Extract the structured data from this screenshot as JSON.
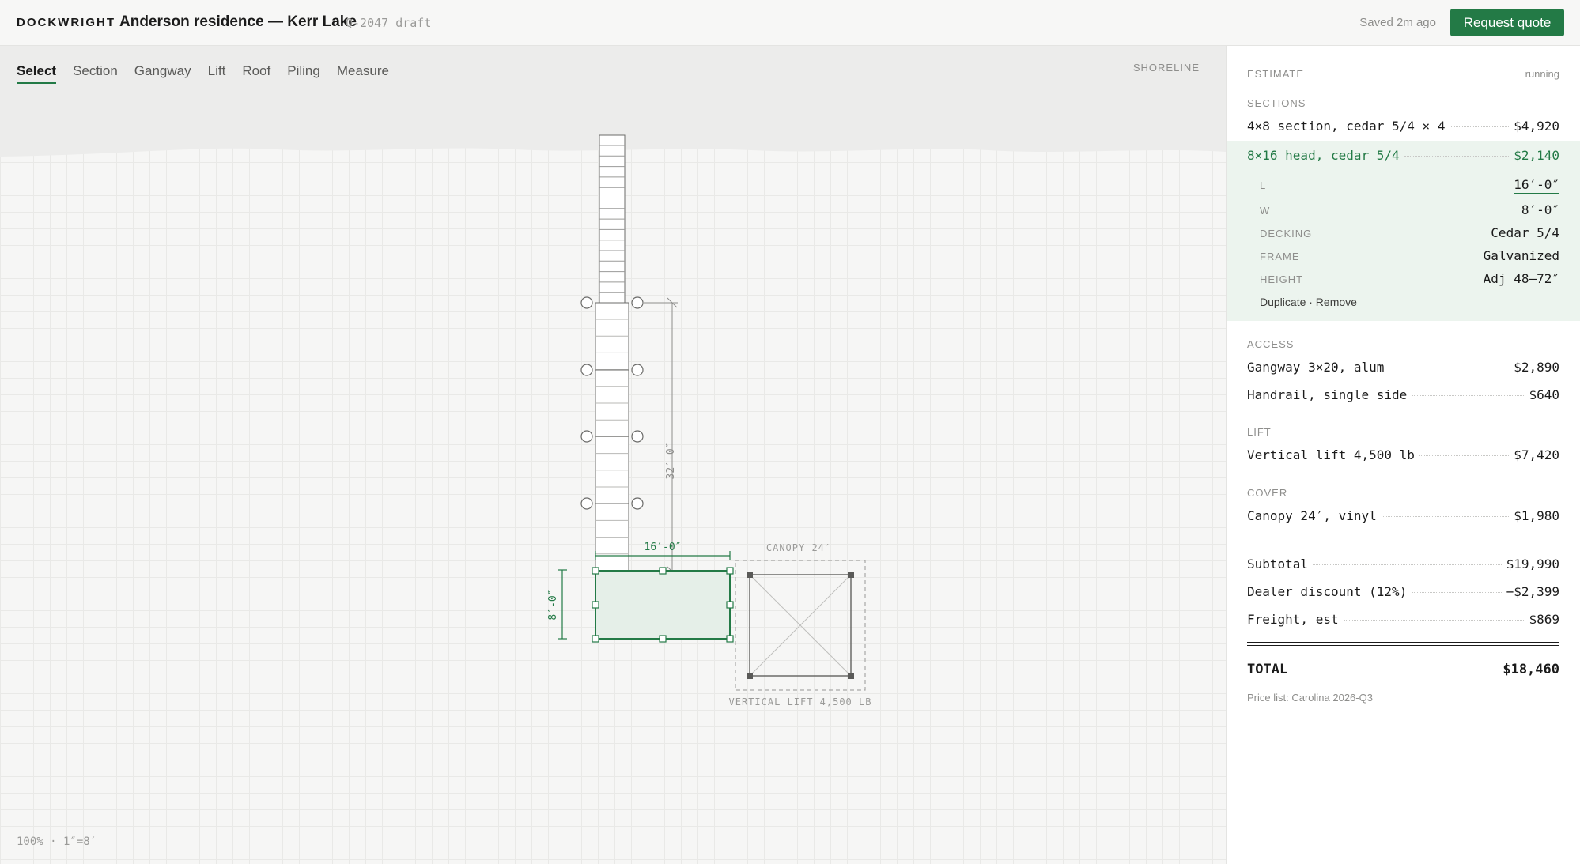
{
  "header": {
    "brand": "DOCKWRIGHT",
    "project_title": "Anderson residence — Kerr Lake",
    "quote_id": "Q-2047 draft",
    "saved_status": "Saved 2m ago",
    "request_quote_label": "Request quote"
  },
  "toolbar": {
    "tools": [
      "Select",
      "Section",
      "Gangway",
      "Lift",
      "Roof",
      "Piling",
      "Measure"
    ],
    "active": "Select"
  },
  "canvas": {
    "shoreline_label": "SHORELINE",
    "zoom_label": "100% · 1″=8′",
    "dim_length": "32′-0″",
    "dim_head_width": "16′-0″",
    "dim_head_depth": "8′-0″",
    "canopy_label": "CANOPY 24′",
    "lift_label": "VERTICAL LIFT 4,500 LB",
    "colors": {
      "accent": "#237a46",
      "selected_fill": "#e5efe8",
      "line": "#6b6b69"
    }
  },
  "estimate": {
    "title": "ESTIMATE",
    "status": "running",
    "sections_label": "SECTIONS",
    "sections": [
      {
        "name": "4×8 section, cedar 5/4 × 4",
        "price": "$4,920"
      },
      {
        "name": "8×16 head, cedar 5/4",
        "price": "$2,140"
      }
    ],
    "selected_props": [
      {
        "key": "L",
        "value": "16′-0″"
      },
      {
        "key": "W",
        "value": "8′-0″"
      },
      {
        "key": "DECKING",
        "value": "Cedar 5/4"
      },
      {
        "key": "FRAME",
        "value": "Galvanized"
      },
      {
        "key": "HEIGHT",
        "value": "Adj 48–72″"
      }
    ],
    "selected_actions": "Duplicate · Remove",
    "access_label": "ACCESS",
    "access": [
      {
        "name": "Gangway 3×20, alum",
        "price": "$2,890"
      },
      {
        "name": "Handrail, single side",
        "price": "$640"
      }
    ],
    "lift_label": "LIFT",
    "lift": [
      {
        "name": "Vertical lift 4,500 lb",
        "price": "$7,420"
      }
    ],
    "cover_label": "COVER",
    "cover": [
      {
        "name": "Canopy 24′, vinyl",
        "price": "$1,980"
      }
    ],
    "subtotal": {
      "name": "Subtotal",
      "price": "$19,990"
    },
    "discount": {
      "name": "Dealer discount (12%)",
      "price": "−$2,399"
    },
    "freight": {
      "name": "Freight, est",
      "price": "$869"
    },
    "total": {
      "name": "TOTAL",
      "price": "$18,460"
    },
    "price_list": "Price list: Carolina 2026-Q3"
  }
}
